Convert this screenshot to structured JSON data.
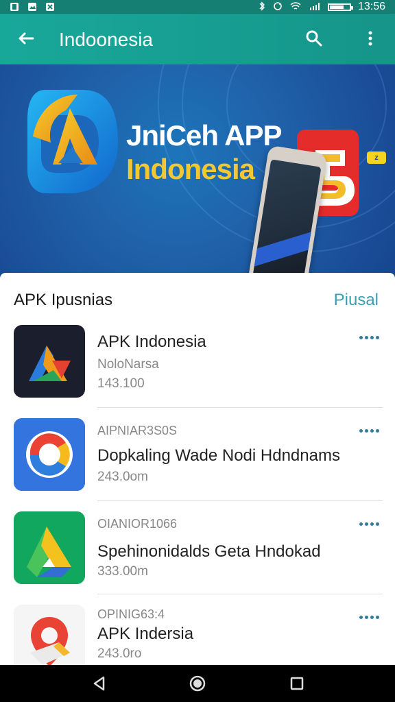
{
  "status_bar": {
    "time": "13:56",
    "icons": [
      "notification-app-icon",
      "image-icon",
      "download-icon",
      "bluetooth-icon",
      "sync-icon",
      "wifi-icon",
      "signal-icon",
      "battery-icon"
    ]
  },
  "app_bar": {
    "title": "Indoonesia",
    "icons": [
      "back-arrow-icon",
      "search-icon",
      "more-vertical-icon"
    ]
  },
  "banner": {
    "title": "JniCeh APP",
    "subtitle": "Indonesia",
    "badge": "z",
    "icons": [
      "app-logo",
      "phone-mockup",
      "red-app-tile",
      "arrow-icon"
    ]
  },
  "section": {
    "title": "APK Ipusnias",
    "action": "Piusal"
  },
  "apps": [
    {
      "title": "APK Indonesia",
      "meta": "NoloNarsa",
      "size": "143.100"
    },
    {
      "title": "Dopkaling Wade Nodi Hdndnams",
      "meta": "AIPNIAR3S0S",
      "size": "243.0om"
    },
    {
      "title": "Spehinonidalds Geta Hndokad",
      "meta": "OIANIOR1066",
      "size": "333.00m"
    },
    {
      "title": "APK Indersia",
      "meta": "OPINIG63:4",
      "size": "243.0ro"
    }
  ],
  "navigation": {
    "icons": [
      "back-triangle-icon",
      "home-circle-icon",
      "recent-square-icon"
    ]
  },
  "colors": {
    "app_bar": "#18a89a",
    "accent": "#35a1b1",
    "banner": "#1f5fa8",
    "primary_text": "#222222",
    "secondary_text": "#888888"
  }
}
